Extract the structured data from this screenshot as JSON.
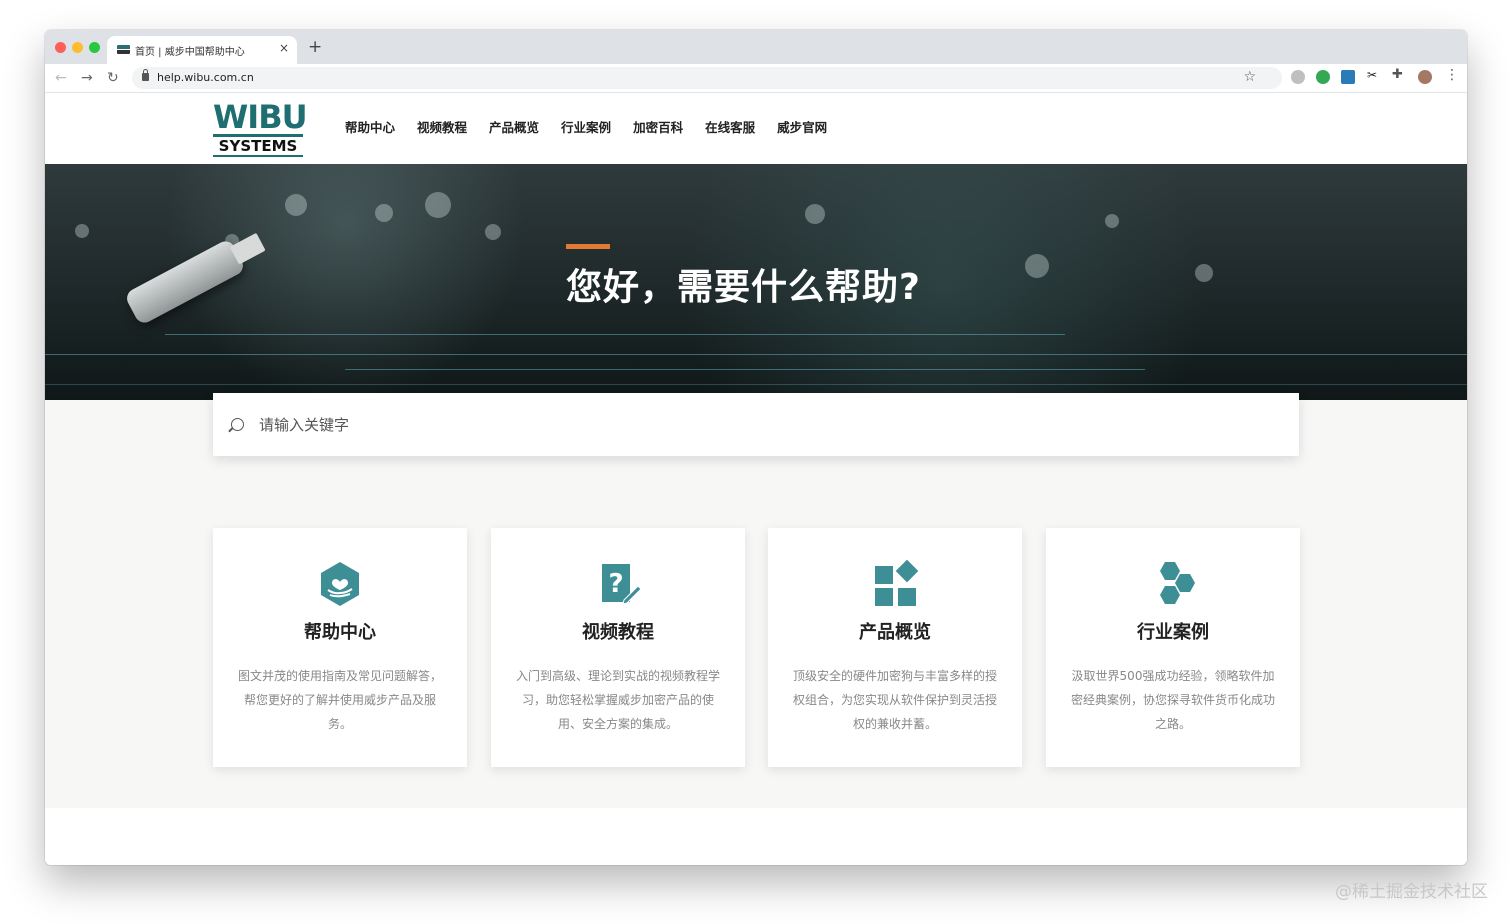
{
  "browser": {
    "tab_title": "首页 | 威步中国帮助中心",
    "tab_close": "×",
    "new_tab": "+",
    "url": "help.wibu.com.cn",
    "back": "←",
    "forward": "→",
    "reload": "↻",
    "star": "☆",
    "menu": "⋮",
    "ext_scissors": "✂",
    "ext_puzzle": "✚"
  },
  "site": {
    "logo_top": "WIBU",
    "logo_bottom": "SYSTEMS",
    "nav": [
      "帮助中心",
      "视频教程",
      "产品概览",
      "行业案例",
      "加密百科",
      "在线客服",
      "威步官网"
    ]
  },
  "hero": {
    "title": "您好，需要什么帮助?"
  },
  "search": {
    "placeholder": "请输入关键字"
  },
  "cards": [
    {
      "icon": "heart-hand-icon",
      "title": "帮助中心",
      "desc": "图文并茂的使用指南及常见问题解答，帮您更好的了解并使用威步产品及服务。"
    },
    {
      "icon": "question-pencil-icon",
      "title": "视频教程",
      "desc": "入门到高级、理论到实战的视频教程学习，助您轻松掌握威步加密产品的使用、安全方案的集成。"
    },
    {
      "icon": "blocks-icon",
      "title": "产品概览",
      "desc": "顶级安全的硬件加密狗与丰富多样的授权组合，为您实现从软件保护到灵活授权的兼收并蓄。"
    },
    {
      "icon": "hexagons-icon",
      "title": "行业案例",
      "desc": "汲取世界500强成功经验，领略软件加密经典案例，协您探寻软件货币化成功之路。"
    }
  ],
  "watermark": "@稀土掘金技术社区",
  "colors": {
    "accent": "#e07a34",
    "brand": "#1f6e72",
    "icon": "#3e8f95"
  }
}
